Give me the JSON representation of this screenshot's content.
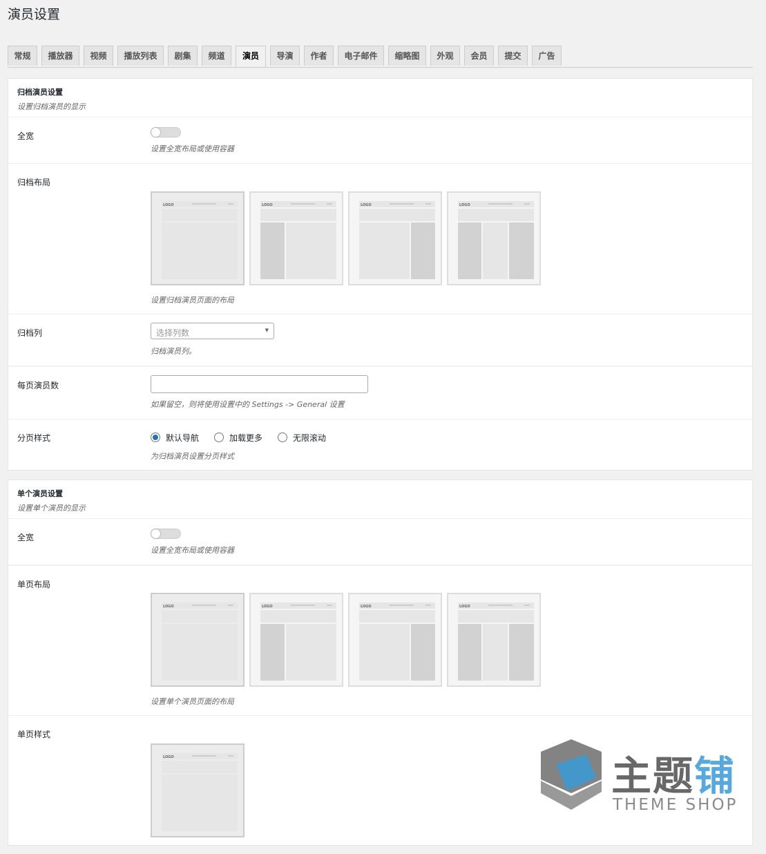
{
  "page_title": "演员设置",
  "tabs": [
    {
      "label": "常规",
      "active": false
    },
    {
      "label": "播放器",
      "active": false
    },
    {
      "label": "视频",
      "active": false
    },
    {
      "label": "播放列表",
      "active": false
    },
    {
      "label": "剧集",
      "active": false
    },
    {
      "label": "频道",
      "active": false
    },
    {
      "label": "演员",
      "active": true
    },
    {
      "label": "导演",
      "active": false
    },
    {
      "label": "作者",
      "active": false
    },
    {
      "label": "电子邮件",
      "active": false
    },
    {
      "label": "缩略图",
      "active": false
    },
    {
      "label": "外观",
      "active": false
    },
    {
      "label": "会员",
      "active": false
    },
    {
      "label": "提交",
      "active": false
    },
    {
      "label": "广告",
      "active": false
    }
  ],
  "archive": {
    "title": "归档演员设置",
    "desc": "设置归档演员的显示",
    "fullwidth": {
      "label": "全宽",
      "desc": "设置全宽布局或使用容器",
      "enabled": false
    },
    "layout": {
      "label": "归档布局",
      "desc": "设置归档演员页面的布局",
      "selected_index": 0
    },
    "columns": {
      "label": "归档列",
      "placeholder": "选择列数",
      "desc": "归档演员列。"
    },
    "per_page": {
      "label": "每页演员数",
      "value": "",
      "desc": "如果留空，则将使用设置中的 Settings -> General 设置"
    },
    "pagination": {
      "label": "分页样式",
      "options": [
        "默认导航",
        "加载更多",
        "无限滚动"
      ],
      "selected": "默认导航",
      "desc": "为归档演员设置分页样式"
    }
  },
  "single": {
    "title": "单个演员设置",
    "desc": "设置单个演员的显示",
    "fullwidth": {
      "label": "全宽",
      "desc": "设置全宽布局或使用容器",
      "enabled": false
    },
    "layout": {
      "label": "单页布局",
      "desc": "设置单个演员页面的布局",
      "selected_index": 0
    },
    "style": {
      "label": "单页样式"
    }
  },
  "layout_thumb": {
    "logo_text": "LOGO"
  },
  "watermark": {
    "text_dark": "主题",
    "text_blue": "铺",
    "sub": "THEME SHOP"
  },
  "colors": {
    "accent": "#1e73be",
    "watermark_blue": "#3a9bd8"
  }
}
